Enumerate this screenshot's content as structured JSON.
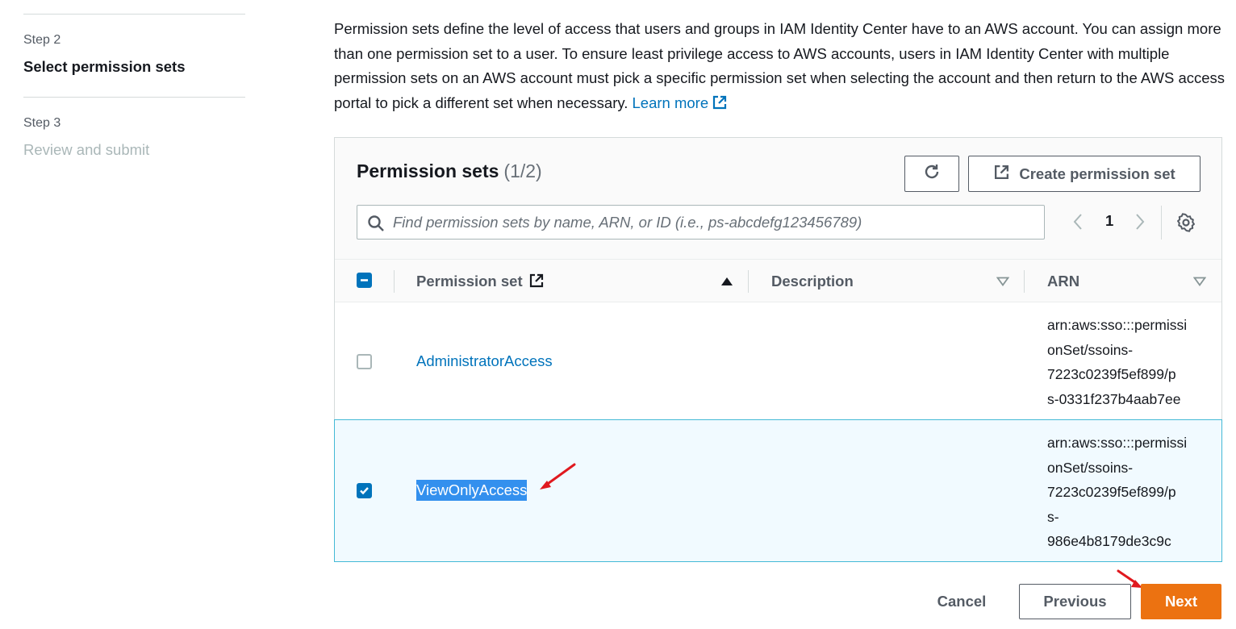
{
  "sidebar": {
    "steps": [
      {
        "number": "Step 2",
        "title": "Select permission sets",
        "state": "active"
      },
      {
        "number": "Step 3",
        "title": "Review and submit",
        "state": "disabled"
      }
    ]
  },
  "intro": {
    "text": "Permission sets define the level of access that users and groups in IAM Identity Center have to an AWS account. You can assign more than one permission set to a user. To ensure least privilege access to AWS accounts, users in IAM Identity Center with multiple permission sets on an AWS account must pick a specific permission set when selecting the account and then return to the AWS access portal to pick a different set when necessary.",
    "learn_more": "Learn more"
  },
  "table": {
    "title": "Permission sets",
    "count": "(1/2)",
    "create_label": "Create permission set",
    "search_placeholder": "Find permission sets by name, ARN, or ID (i.e., ps-abcdefg123456789)",
    "page": "1",
    "columns": {
      "permission_set": "Permission set",
      "description": "Description",
      "arn": "ARN"
    },
    "rows": [
      {
        "name": "AdministratorAccess",
        "description": "",
        "arn_lines": [
          "arn:aws:sso:::permissi",
          "onSet/ssoins-",
          "7223c0239f5ef899/p",
          "s-0331f237b4aab7ee"
        ],
        "checked": false
      },
      {
        "name": "ViewOnlyAccess",
        "description": "",
        "arn_lines": [
          "arn:aws:sso:::permissi",
          "onSet/ssoins-",
          "7223c0239f5ef899/p",
          "s-",
          "986e4b8179de3c9c"
        ],
        "checked": true
      }
    ]
  },
  "footer": {
    "cancel": "Cancel",
    "previous": "Previous",
    "next": "Next"
  },
  "colors": {
    "primary": "#ec7211",
    "link": "#0073bb",
    "selected_row": "#f1faff",
    "annotation_arrow": "#e0191f"
  },
  "icons": [
    "refresh-icon",
    "external-link-icon",
    "search-icon",
    "chevron-left-icon",
    "chevron-right-icon",
    "settings-gear-icon",
    "sort-ascending-icon",
    "sort-descending-icon"
  ]
}
